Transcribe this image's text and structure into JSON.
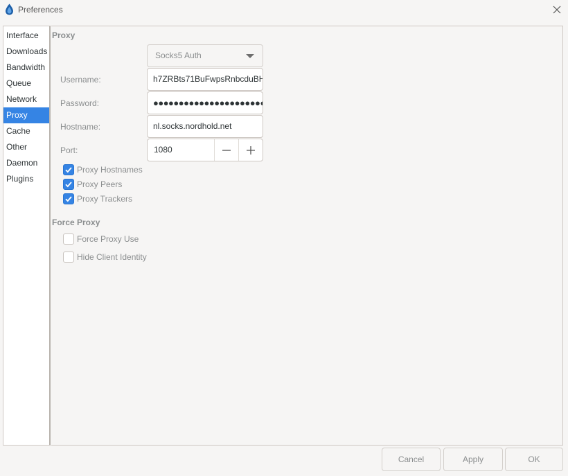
{
  "window": {
    "title": "Preferences"
  },
  "sidebar": {
    "items": [
      {
        "label": "Interface"
      },
      {
        "label": "Downloads"
      },
      {
        "label": "Bandwidth"
      },
      {
        "label": "Queue"
      },
      {
        "label": "Network"
      },
      {
        "label": "Proxy"
      },
      {
        "label": "Cache"
      },
      {
        "label": "Other"
      },
      {
        "label": "Daemon"
      },
      {
        "label": "Plugins"
      }
    ],
    "selected": "Proxy"
  },
  "proxy": {
    "section_title": "Proxy",
    "type_value": "Socks5 Auth",
    "username_label": "Username:",
    "username_value": "h7ZRBts71BuFwpsRnbcduBH",
    "password_label": "Password:",
    "password_value": "●●●●●●●●●●●●●●●●●●●●●●●●",
    "hostname_label": "Hostname:",
    "hostname_value": "nl.socks.nordhold.net",
    "port_label": "Port:",
    "port_value": "1080",
    "checks": [
      {
        "label": "Proxy Hostnames",
        "checked": true
      },
      {
        "label": "Proxy Peers",
        "checked": true
      },
      {
        "label": "Proxy Trackers",
        "checked": true
      }
    ]
  },
  "force_proxy": {
    "section_title": "Force Proxy",
    "checks": [
      {
        "label": "Force Proxy Use",
        "checked": false
      },
      {
        "label": "Hide Client Identity",
        "checked": false
      }
    ]
  },
  "footer": {
    "cancel_label": "Cancel",
    "apply_label": "Apply",
    "ok_label": "OK"
  },
  "colors": {
    "accent": "#3584e4",
    "background": "#f6f5f4",
    "muted_text": "#8b8e8f"
  },
  "icons": {
    "app": "deluge-drop-icon",
    "close": "close-icon",
    "dropdown": "chevron-down-icon",
    "minus": "minus-icon",
    "plus": "plus-icon",
    "check": "check-icon"
  }
}
